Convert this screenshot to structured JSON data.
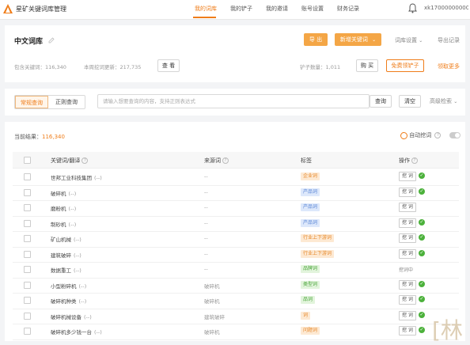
{
  "topbar": {
    "app_title": "星矿关键词库管理",
    "nav": [
      "我的词库",
      "我的铲子",
      "我的邀请",
      "账号设置",
      "财务记录"
    ],
    "active_nav": 0,
    "user": "xk1700000000000"
  },
  "header": {
    "title": "中文词库",
    "export_label": "导 出",
    "add_keyword_label": "新增关键词",
    "settings_label": "词库设置",
    "export_record_label": "导出记录",
    "total_keywords": "包含关键词：116,340",
    "weekly_mined": "本周挖词更新：217,735",
    "view_label": "查 看",
    "shovels": "铲子数量：1,011",
    "buy_label": "购 买",
    "free_shovel_label": "免费领铲子",
    "collect_more_label": "领取更多"
  },
  "query": {
    "mode_standard": "常规查询",
    "mode_regex": "正则查询",
    "placeholder": "请输入想要查询的内容，支持正则表达式",
    "search_label": "查询",
    "clear_label": "清空",
    "advanced_label": "高级检索"
  },
  "results": {
    "label": "当前结果：",
    "count": "116,340",
    "auto_mine_label": "自动挖词"
  },
  "table": {
    "headers": {
      "keyword": "关键词/翻译",
      "source": "来源词",
      "tag": "标签",
      "action": "操作"
    },
    "rows": [
      {
        "keyword": "世邦工业科技集团",
        "suffix": "(--)",
        "source": "--",
        "tag": "企业词",
        "tag_color": "orange",
        "action": "挖 词",
        "done": true
      },
      {
        "keyword": "破碎机",
        "suffix": "(--)",
        "source": "--",
        "tag": "产品词",
        "tag_color": "blue",
        "action": "挖 词",
        "done": true
      },
      {
        "keyword": "磨粉机",
        "suffix": "(--)",
        "source": "--",
        "tag": "产品词",
        "tag_color": "blue",
        "action": "挖 词",
        "done": false
      },
      {
        "keyword": "制砂机",
        "suffix": "(--)",
        "source": "--",
        "tag": "产品词",
        "tag_color": "blue",
        "action": "挖 词",
        "done": true
      },
      {
        "keyword": "矿山机械",
        "suffix": "(--)",
        "source": "--",
        "tag": "行业上下游词",
        "tag_color": "orange",
        "action": "挖 词",
        "done": true
      },
      {
        "keyword": "建筑破碎",
        "suffix": "(--)",
        "source": "--",
        "tag": "行业上下游词",
        "tag_color": "orange",
        "action": "挖 词",
        "done": true
      },
      {
        "keyword": "数据重工",
        "suffix": "(--)",
        "source": "--",
        "tag": "品牌词",
        "tag_color": "green",
        "action": "挖词中",
        "done": false
      },
      {
        "keyword": "小型粉碎机",
        "suffix": "(--)",
        "source": "破碎机",
        "tag": "类型词",
        "tag_color": "green",
        "action": "挖 词",
        "done": true
      },
      {
        "keyword": "破碎机种类",
        "suffix": "(--)",
        "source": "破碎机",
        "tag": "品词",
        "tag_color": "green",
        "action": "挖 词",
        "done": true
      },
      {
        "keyword": "破碎机械设备",
        "suffix": "(--)",
        "source": "建筑破碎",
        "tag": "词",
        "tag_color": "orange",
        "action": "挖 词",
        "done": true
      },
      {
        "keyword": "破碎机多少钱一台",
        "suffix": "(--)",
        "source": "破碎机",
        "tag": "问题词",
        "tag_color": "orange",
        "action": "挖 词",
        "done": true
      }
    ]
  },
  "watermark": "[林",
  "colors": {
    "accent": "#ef7d1a",
    "button": "#f4a646",
    "success": "#4cb13b"
  }
}
